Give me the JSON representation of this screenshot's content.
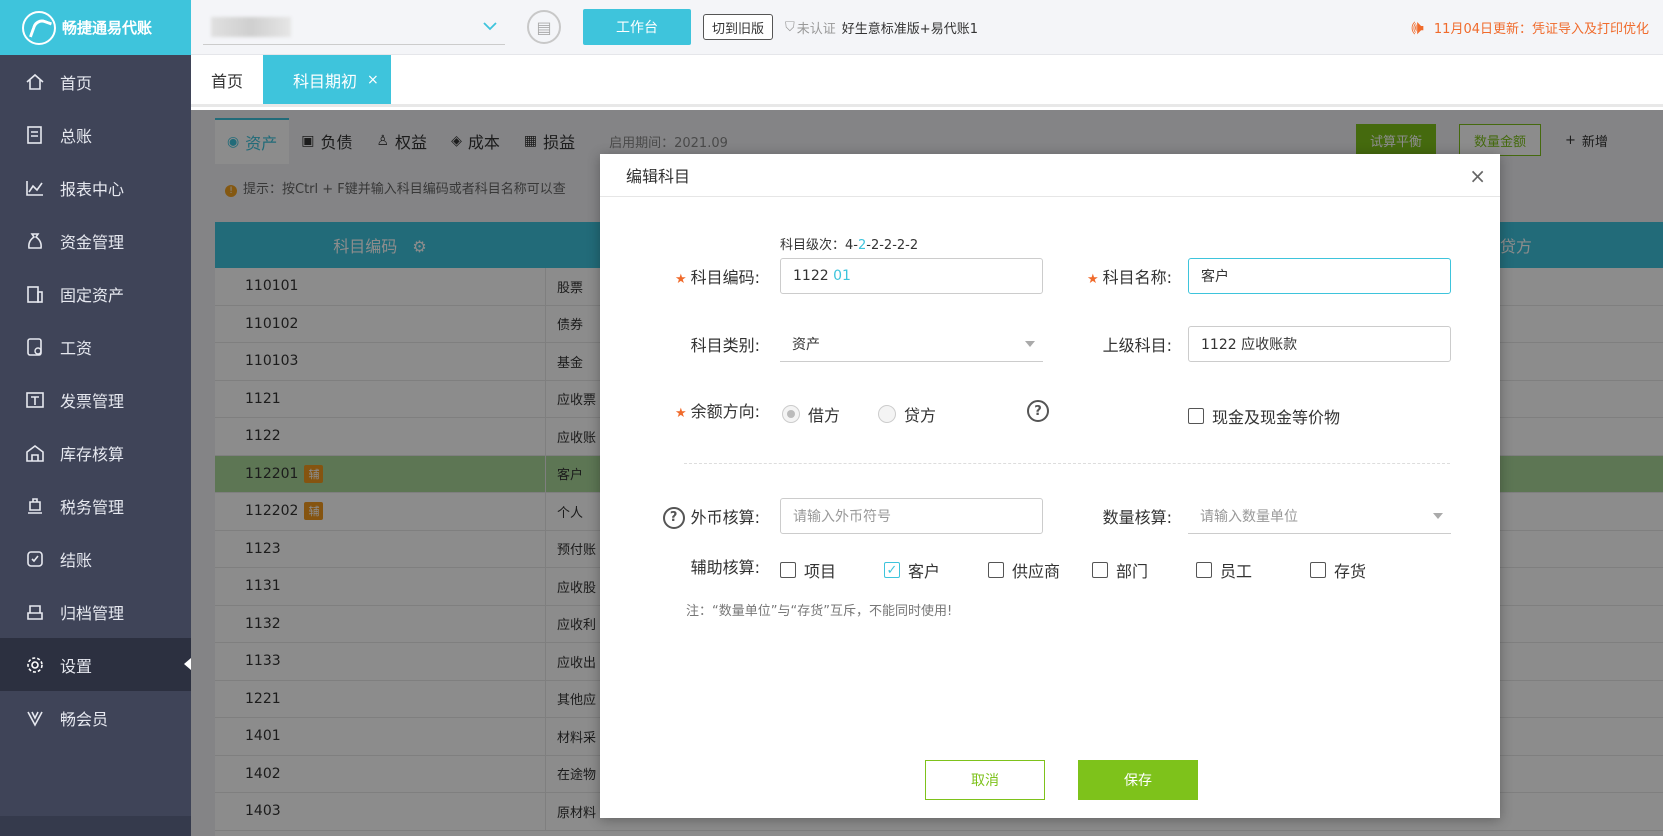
{
  "app": {
    "logo_text": "畅捷通易代账"
  },
  "sidebar": {
    "items": [
      {
        "label": "首页"
      },
      {
        "label": "总账"
      },
      {
        "label": "报表中心"
      },
      {
        "label": "资金管理"
      },
      {
        "label": "固定资产"
      },
      {
        "label": "工资"
      },
      {
        "label": "发票管理"
      },
      {
        "label": "库存核算"
      },
      {
        "label": "税务管理"
      },
      {
        "label": "结账"
      },
      {
        "label": "归档管理"
      },
      {
        "label": "设置"
      },
      {
        "label": "畅会员"
      }
    ],
    "active": "设置"
  },
  "topbar": {
    "workbench_label": "工作台",
    "switch_old_label": "切到旧版",
    "cert_label": "未认证",
    "edition_label": "好生意标准版+易代账1",
    "notice": "11月04日更新：凭证导入及打印优化"
  },
  "page_tabs": [
    {
      "label": "首页"
    },
    {
      "label": "科目期初",
      "close": "×"
    }
  ],
  "category_tabs": [
    {
      "label": "资产"
    },
    {
      "label": "负债"
    },
    {
      "label": "权益"
    },
    {
      "label": "成本"
    },
    {
      "label": "损益"
    }
  ],
  "period_label": "启用期间：2021.09",
  "toolbar": {
    "trial_label": "试算平衡",
    "qty_label": "数量金额",
    "add_label": "新增"
  },
  "tip": "提示：按Ctrl + F键并输入科目编码或者科目名称可以查",
  "grid": {
    "header_code": "科目编码",
    "header_credit": "贷方",
    "badge": "辅",
    "rows": [
      {
        "code": "110101",
        "name": "股票"
      },
      {
        "code": "110102",
        "name": "债券"
      },
      {
        "code": "110103",
        "name": "基金"
      },
      {
        "code": "1121",
        "name": "应收票"
      },
      {
        "code": "1122",
        "name": "应收账"
      },
      {
        "code": "112201",
        "name": "客户"
      },
      {
        "code": "112202",
        "name": "个人"
      },
      {
        "code": "1123",
        "name": "预付账"
      },
      {
        "code": "1131",
        "name": "应收股"
      },
      {
        "code": "1132",
        "name": "应收利"
      },
      {
        "code": "1133",
        "name": "应收出"
      },
      {
        "code": "1221",
        "name": "其他应"
      },
      {
        "code": "1401",
        "name": "材料采"
      },
      {
        "code": "1402",
        "name": "在途物"
      },
      {
        "code": "1403",
        "name": "原材料"
      }
    ]
  },
  "modal": {
    "title": "编辑科目",
    "close": "×",
    "level_label": "科目级次：",
    "level_a": "4-",
    "level_b": "2",
    "level_c": "-2-2-2-2",
    "code_label": "科目编码:",
    "code_prefix": "1122",
    "code_suffix": "01",
    "name_label": "科目名称:",
    "name_value": "客户",
    "type_label": "科目类别:",
    "type_value": "资产",
    "parent_label": "上级科目:",
    "parent_value": "1122 应收账款",
    "direction_label": "余额方向:",
    "debit_label": "借方",
    "credit_label": "贷方",
    "cash_label": "现金及现金等价物",
    "fx_label": "外币核算:",
    "fx_placeholder": "请输入外币符号",
    "qty_label": "数量核算:",
    "qty_placeholder": "请输入数量单位",
    "aux_label": "辅助核算:",
    "aux_options": [
      {
        "label": "项目",
        "checked": false
      },
      {
        "label": "客户",
        "checked": true
      },
      {
        "label": "供应商",
        "checked": false
      },
      {
        "label": "部门",
        "checked": false
      },
      {
        "label": "员工",
        "checked": false
      },
      {
        "label": "存货",
        "checked": false
      }
    ],
    "note": "注：“数量单位”与“存货”互斥，不能同时使用!",
    "cancel_label": "取消",
    "save_label": "保存"
  }
}
